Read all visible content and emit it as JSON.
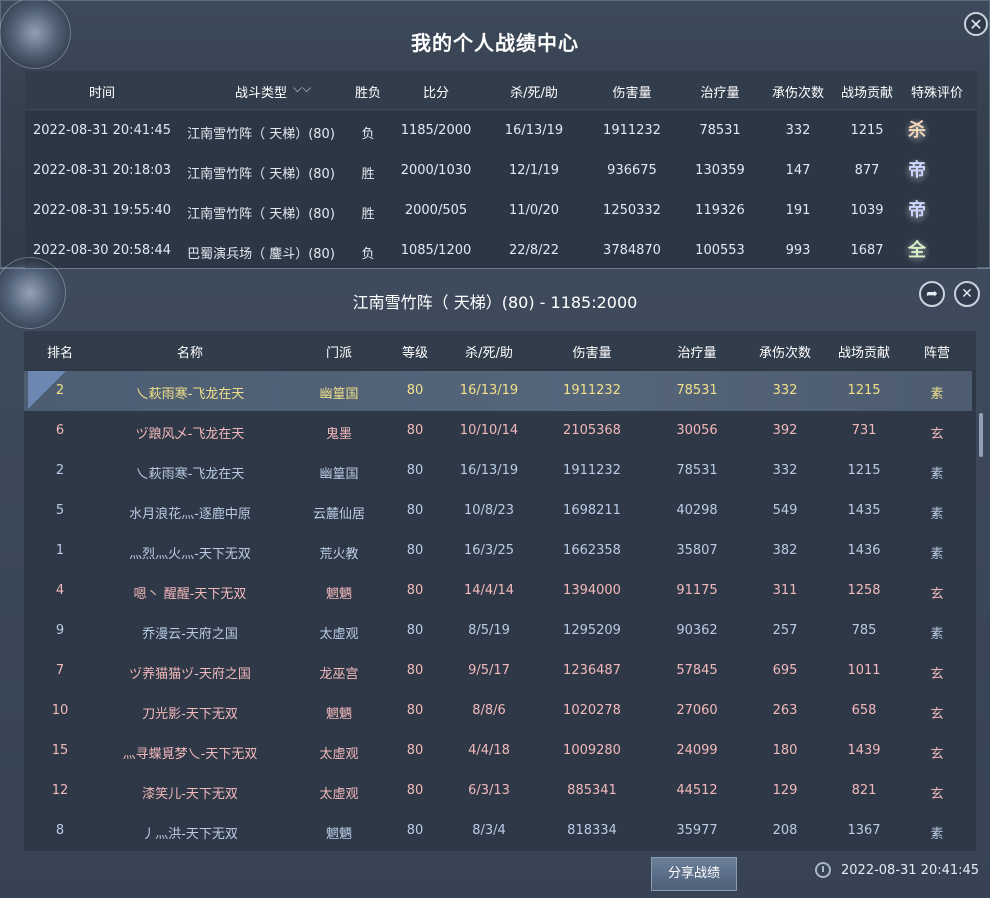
{
  "top": {
    "title": "我的个人战绩中心",
    "close": "✕",
    "headers": [
      "时间",
      "战斗类型",
      "胜负",
      "比分",
      "杀/死/助",
      "伤害量",
      "治疗量",
      "承伤次数",
      "战场贡献",
      "特殊评价"
    ],
    "filter_icon": "chevron-down-icon",
    "rows": [
      {
        "time": "2022-08-31 20:41:45",
        "type": "江南雪竹阵（ 天梯）(80)",
        "result": "负",
        "score": "1185/2000",
        "kda": "16/13/19",
        "damage": "1911232",
        "heal": "78531",
        "hits": "332",
        "contrib": "1215",
        "rating": "杀",
        "rating_color": "#f3d6b8"
      },
      {
        "time": "2022-08-31 20:18:03",
        "type": "江南雪竹阵（ 天梯）(80)",
        "result": "胜",
        "score": "2000/1030",
        "kda": "12/1/19",
        "damage": "936675",
        "heal": "130359",
        "hits": "147",
        "contrib": "877",
        "rating": "帝",
        "rating_color": "#c9d6ff"
      },
      {
        "time": "2022-08-31 19:55:40",
        "type": "江南雪竹阵（ 天梯）(80)",
        "result": "胜",
        "score": "2000/505",
        "kda": "11/0/20",
        "damage": "1250332",
        "heal": "119326",
        "hits": "191",
        "contrib": "1039",
        "rating": "帝",
        "rating_color": "#c9d6ff"
      },
      {
        "time": "2022-08-30 20:58:44",
        "type": "巴蜀演兵场（ 鏖斗）(80)",
        "result": "负",
        "score": "1085/1200",
        "kda": "22/8/22",
        "damage": "3784870",
        "heal": "100553",
        "hits": "993",
        "contrib": "1687",
        "rating": "全",
        "rating_color": "#d7f2c8"
      }
    ]
  },
  "detail": {
    "title": "江南雪竹阵（ 天梯）(80) - 1185:2000",
    "share_icon": "share-arrow-icon",
    "close": "✕",
    "headers": [
      "排名",
      "名称",
      "门派",
      "等级",
      "杀/死/助",
      "伤害量",
      "治疗量",
      "承伤次数",
      "战场贡献",
      "阵营"
    ],
    "rows": [
      {
        "rank": "2",
        "name": "乀萩雨寒-飞龙在天",
        "school": "幽篁国",
        "level": "80",
        "kda": "16/13/19",
        "damage": "1911232",
        "heal": "78531",
        "hits": "332",
        "contrib": "1215",
        "camp": "素",
        "style": "selected"
      },
      {
        "rank": "6",
        "name": "ヅ踉风乄-飞龙在天",
        "school": "鬼墨",
        "level": "80",
        "kda": "10/10/14",
        "damage": "2105368",
        "heal": "30056",
        "hits": "392",
        "contrib": "731",
        "camp": "玄",
        "style": "red"
      },
      {
        "rank": "2",
        "name": "乀萩雨寒-飞龙在天",
        "school": "幽篁国",
        "level": "80",
        "kda": "16/13/19",
        "damage": "1911232",
        "heal": "78531",
        "hits": "332",
        "contrib": "1215",
        "camp": "素",
        "style": "blue"
      },
      {
        "rank": "5",
        "name": "水月浪花灬-逐鹿中原",
        "school": "云麓仙居",
        "level": "80",
        "kda": "10/8/23",
        "damage": "1698211",
        "heal": "40298",
        "hits": "549",
        "contrib": "1435",
        "camp": "素",
        "style": "blue"
      },
      {
        "rank": "1",
        "name": "灬烈灬火灬-天下无双",
        "school": "荒火教",
        "level": "80",
        "kda": "16/3/25",
        "damage": "1662358",
        "heal": "35807",
        "hits": "382",
        "contrib": "1436",
        "camp": "素",
        "style": "blue"
      },
      {
        "rank": "4",
        "name": "嗯丶 醒醒-天下无双",
        "school": "魍魉",
        "level": "80",
        "kda": "14/4/14",
        "damage": "1394000",
        "heal": "91175",
        "hits": "311",
        "contrib": "1258",
        "camp": "玄",
        "style": "red"
      },
      {
        "rank": "9",
        "name": "乔漫云-天府之国",
        "school": "太虚观",
        "level": "80",
        "kda": "8/5/19",
        "damage": "1295209",
        "heal": "90362",
        "hits": "257",
        "contrib": "785",
        "camp": "素",
        "style": "blue"
      },
      {
        "rank": "7",
        "name": "ヅ养猫猫ヅ-天府之国",
        "school": "龙巫宫",
        "level": "80",
        "kda": "9/5/17",
        "damage": "1236487",
        "heal": "57845",
        "hits": "695",
        "contrib": "1011",
        "camp": "玄",
        "style": "red"
      },
      {
        "rank": "10",
        "name": "刀光影-天下无双",
        "school": "魍魉",
        "level": "80",
        "kda": "8/8/6",
        "damage": "1020278",
        "heal": "27060",
        "hits": "263",
        "contrib": "658",
        "camp": "玄",
        "style": "red"
      },
      {
        "rank": "15",
        "name": "灬寻蝶覓梦乀-天下无双",
        "school": "太虚观",
        "level": "80",
        "kda": "4/4/18",
        "damage": "1009280",
        "heal": "24099",
        "hits": "180",
        "contrib": "1439",
        "camp": "玄",
        "style": "red"
      },
      {
        "rank": "12",
        "name": "漆笑儿-天下无双",
        "school": "太虚观",
        "level": "80",
        "kda": "6/3/13",
        "damage": "885341",
        "heal": "44512",
        "hits": "129",
        "contrib": "821",
        "camp": "玄",
        "style": "red"
      },
      {
        "rank": "8",
        "name": "丿灬洪-天下无双",
        "school": "魍魉",
        "level": "80",
        "kda": "8/3/4",
        "damage": "818334",
        "heal": "35977",
        "hits": "208",
        "contrib": "1367",
        "camp": "素",
        "style": "blue"
      }
    ],
    "share_label": "分享战绩",
    "timestamp": "2022-08-31 20:41:45"
  }
}
